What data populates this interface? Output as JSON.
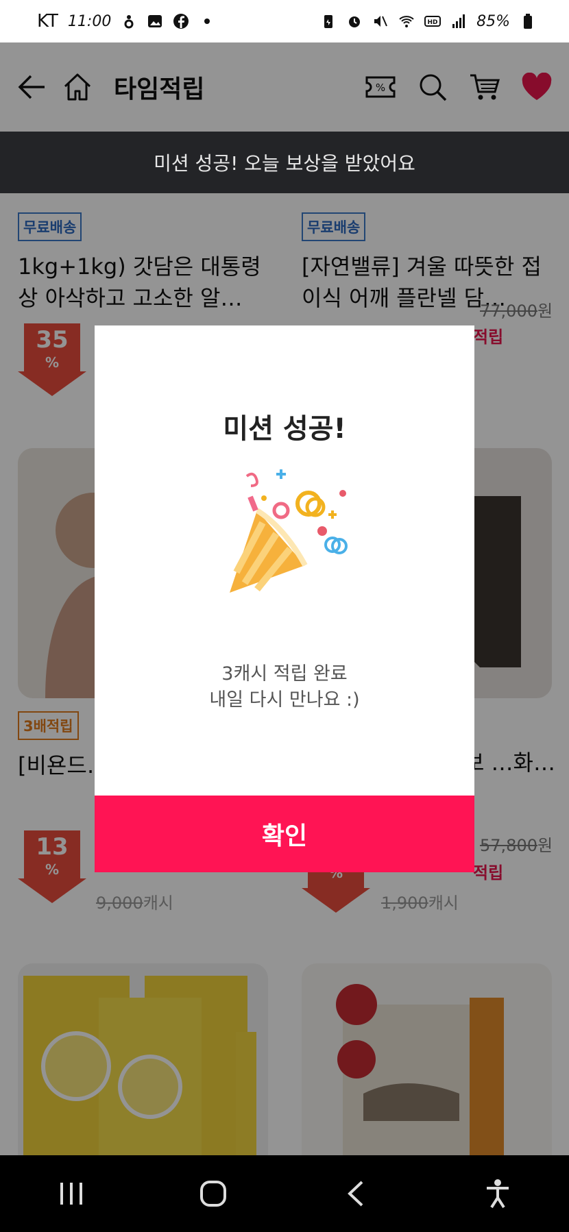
{
  "status_bar": {
    "carrier": "KT",
    "time": "11:00",
    "battery": "85%"
  },
  "app_bar": {
    "title": "타임적립",
    "icons": [
      "back-arrow-icon",
      "home-icon",
      "coupon-percent-icon",
      "search-icon",
      "cart-icon",
      "heart-icon"
    ],
    "heart_color": "#e8154d"
  },
  "toast": {
    "message": "미션 성공! 오늘 보상을 받았어요"
  },
  "products": [
    {
      "badge": "무료배송",
      "title": "1kg+1kg) 갓담은 대통령 상 아삭하고 고소한 알…",
      "discount": "35",
      "discount_unit": "%"
    },
    {
      "badge": "무료배송",
      "title": "[자연밸류] 겨울 따뜻한 접이식 어깨 플란넬 담…",
      "original_price": "77,000",
      "price_unit": "원",
      "reward": "적립"
    },
    {
      "badge": "3배적립",
      "title": "[비욘드… 카무트 …",
      "discount": "13",
      "discount_unit": "%",
      "cash_original": "9,000",
      "cash_unit": "캐시"
    },
    {
      "title": "…온 에보 …화…",
      "original_price": "57,800",
      "price_unit": "원",
      "reward": "적립",
      "discount_unit": "%",
      "cash_original": "1,900",
      "cash_unit": "캐시"
    }
  ],
  "modal": {
    "title": "미션 성공!",
    "illustration": "party-popper-icon",
    "message_line1": "3캐시 적립 완료",
    "message_line2": "내일 다시 만나요 :)",
    "confirm_label": "확인",
    "confirm_color": "#ff1454"
  },
  "nav_bar": {
    "icons": [
      "recent-apps-icon",
      "home-button-icon",
      "back-icon",
      "accessibility-icon"
    ]
  }
}
